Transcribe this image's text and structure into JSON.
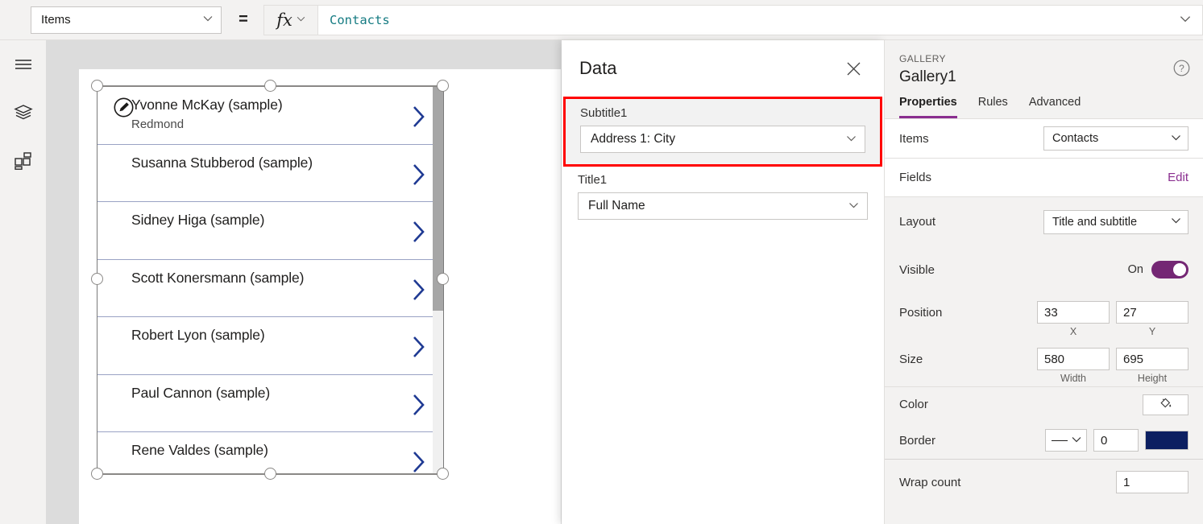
{
  "formula_bar": {
    "property_selector": "Items",
    "equals": "=",
    "fx_label": "fx",
    "formula_value": "Contacts"
  },
  "left_rail": {
    "items": [
      {
        "name": "menu-icon",
        "label": "Menu"
      },
      {
        "name": "tree-view-icon",
        "label": "Tree view"
      },
      {
        "name": "insert-icon",
        "label": "Insert"
      }
    ]
  },
  "canvas": {
    "gallery": {
      "items": [
        {
          "title": "Yvonne McKay (sample)",
          "subtitle": "Redmond"
        },
        {
          "title": "Susanna Stubberod (sample)",
          "subtitle": ""
        },
        {
          "title": "Sidney Higa (sample)",
          "subtitle": ""
        },
        {
          "title": "Scott Konersmann (sample)",
          "subtitle": ""
        },
        {
          "title": "Robert Lyon (sample)",
          "subtitle": ""
        },
        {
          "title": "Paul Cannon (sample)",
          "subtitle": ""
        },
        {
          "title": "Rene Valdes (sample)",
          "subtitle": ""
        }
      ]
    }
  },
  "data_panel": {
    "title": "Data",
    "close_label": "✕",
    "fields": [
      {
        "label": "Subtitle1",
        "value": "Address 1: City",
        "highlighted": true
      },
      {
        "label": "Title1",
        "value": "Full Name",
        "highlighted": false
      }
    ]
  },
  "properties_panel": {
    "kicker": "GALLERY",
    "control_name": "Gallery1",
    "tabs": [
      {
        "label": "Properties",
        "active": true
      },
      {
        "label": "Rules",
        "active": false
      },
      {
        "label": "Advanced",
        "active": false
      }
    ],
    "rows": {
      "items": {
        "label": "Items",
        "value": "Contacts"
      },
      "fields": {
        "label": "Fields",
        "action": "Edit"
      },
      "layout": {
        "label": "Layout",
        "value": "Title and subtitle"
      },
      "visible": {
        "label": "Visible",
        "state": "On"
      },
      "position": {
        "label": "Position",
        "x": "33",
        "y": "27",
        "x_caption": "X",
        "y_caption": "Y"
      },
      "size": {
        "label": "Size",
        "width": "580",
        "height": "695",
        "width_caption": "Width",
        "height_caption": "Height"
      },
      "color": {
        "label": "Color"
      },
      "border": {
        "label": "Border",
        "thickness": "0",
        "color_hex": "#0c1f61"
      },
      "wrap_count": {
        "label": "Wrap count",
        "value": "1"
      }
    }
  },
  "colors": {
    "accent_purple": "#742774",
    "link_purple": "#8a2e8f",
    "formula_teal": "#157b82",
    "chevron_navy": "#1f3a93",
    "highlight_red": "#ff0000",
    "border_navy": "#0c1f61"
  }
}
